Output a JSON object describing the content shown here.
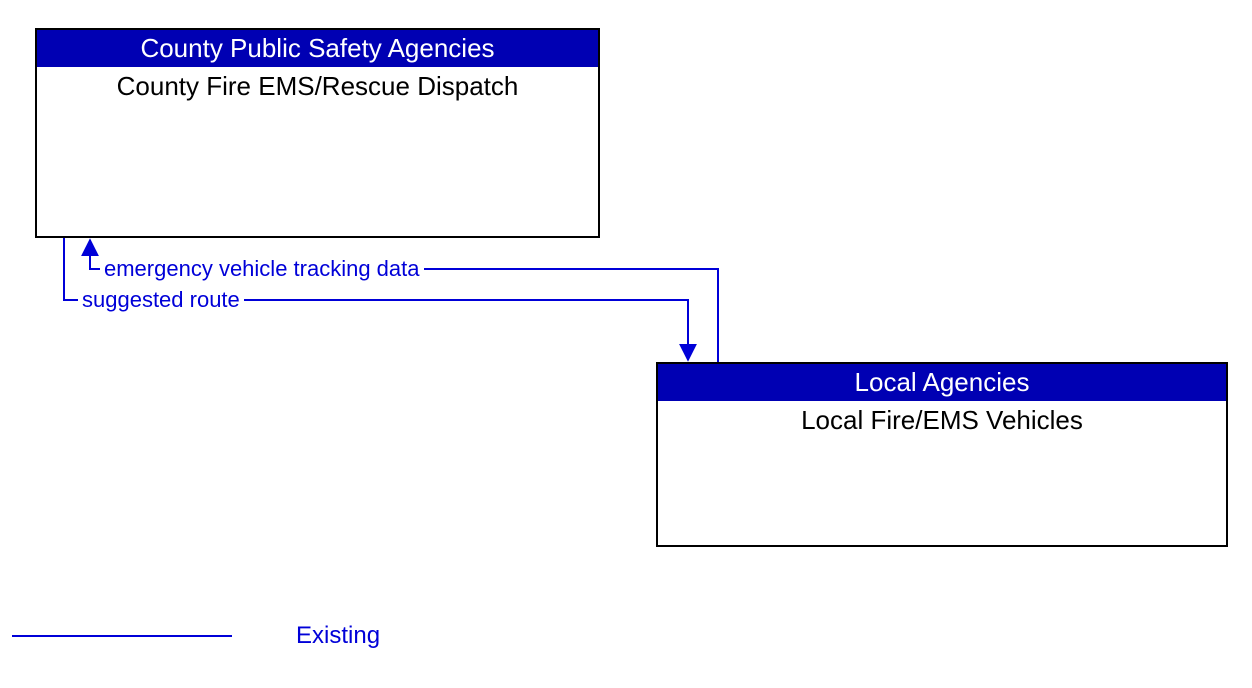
{
  "boxes": {
    "top": {
      "header": "County Public Safety Agencies",
      "body": "County Fire EMS/Rescue Dispatch"
    },
    "bottom": {
      "header": "Local Agencies",
      "body": "Local Fire/EMS Vehicles"
    }
  },
  "flows": {
    "up": "emergency vehicle tracking data",
    "down": "suggested route"
  },
  "legend": {
    "existing": "Existing"
  },
  "colors": {
    "header_bg": "#0000b3",
    "line": "#0000d8"
  }
}
